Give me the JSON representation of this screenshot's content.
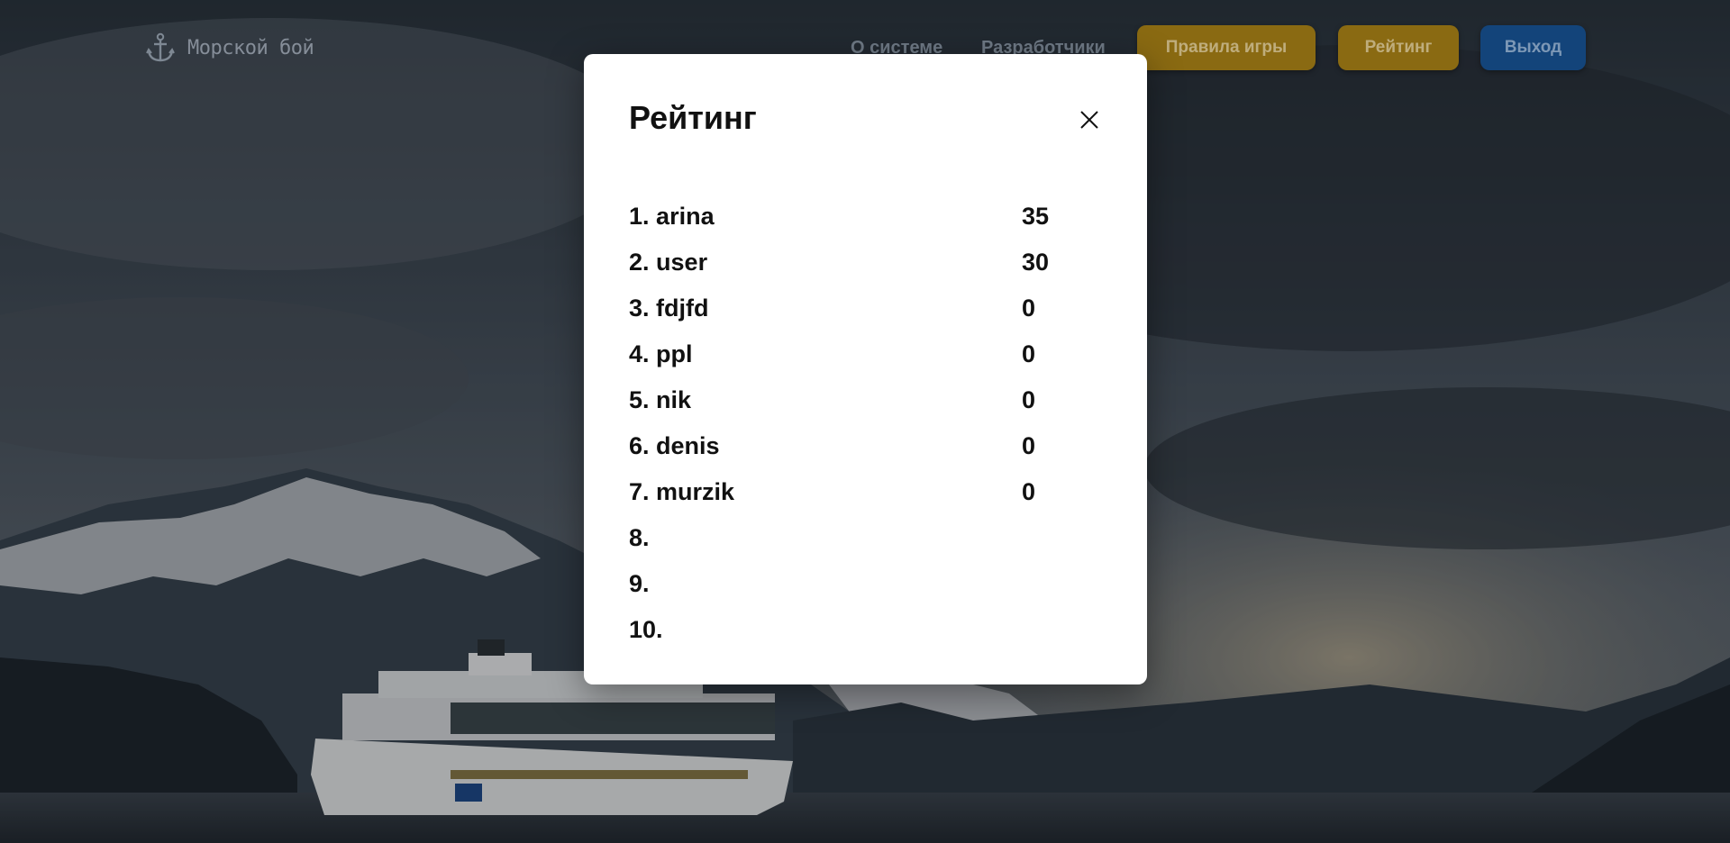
{
  "header": {
    "logo_text": "Морской бой",
    "nav_links": [
      "О системе",
      "Разработчики"
    ],
    "buttons": {
      "rules": "Правила игры",
      "rating": "Рейтинг",
      "exit": "Выход"
    }
  },
  "colors": {
    "gold_button": "#8a6a12",
    "blue_button": "#13447a",
    "modal_bg": "#ffffff"
  },
  "icons": {
    "logo": "anchor-icon",
    "close": "close-icon"
  },
  "modal": {
    "title": "Рейтинг",
    "rows": [
      {
        "rank": "1.",
        "name": "arina",
        "score": "35"
      },
      {
        "rank": "2.",
        "name": "user",
        "score": "30"
      },
      {
        "rank": "3.",
        "name": "fdjfd",
        "score": "0"
      },
      {
        "rank": "4.",
        "name": "ppl",
        "score": "0"
      },
      {
        "rank": "5.",
        "name": "nik",
        "score": "0"
      },
      {
        "rank": "6.",
        "name": "denis",
        "score": "0"
      },
      {
        "rank": "7.",
        "name": "murzik",
        "score": "0"
      },
      {
        "rank": "8.",
        "name": "",
        "score": ""
      },
      {
        "rank": "9.",
        "name": "",
        "score": ""
      },
      {
        "rank": "10.",
        "name": "",
        "score": ""
      }
    ]
  }
}
